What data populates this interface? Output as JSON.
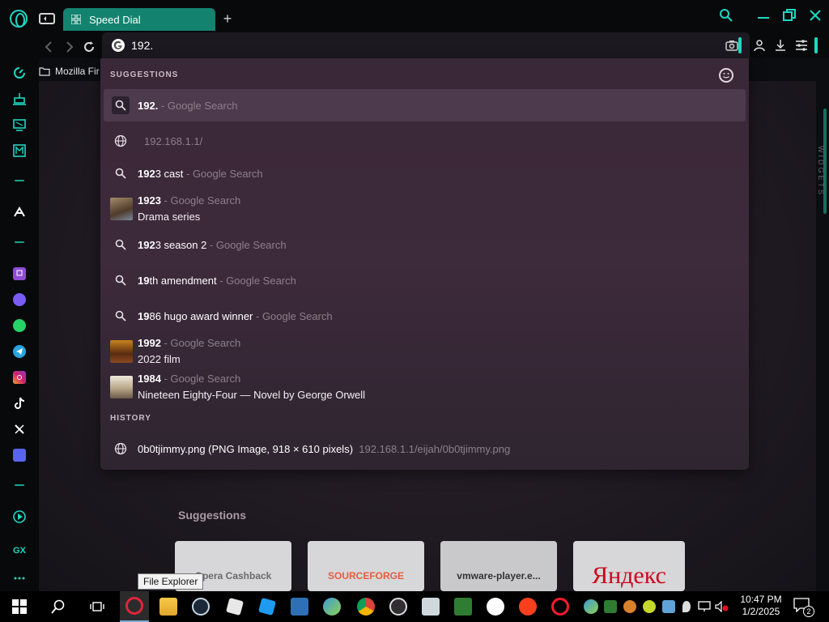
{
  "tab": {
    "title": "Speed Dial"
  },
  "address": {
    "value": "192."
  },
  "bookmarks": {
    "item": "Mozilla Fir"
  },
  "dropdown": {
    "heading": "SUGGESTIONS",
    "history_heading": "HISTORY",
    "rows": [
      {
        "bold": "192.",
        "rest": "",
        "suffix": " - Google Search",
        "sub": ""
      },
      {
        "bold": "",
        "rest": "",
        "suffix": "192.168.1.1/",
        "sub": ""
      },
      {
        "bold": "192",
        "rest": "3 cast",
        "suffix": " - Google Search",
        "sub": ""
      },
      {
        "bold": "1923",
        "rest": "",
        "suffix": " - Google Search",
        "sub": "Drama series"
      },
      {
        "bold": "192",
        "rest": "3 season 2",
        "suffix": " - Google Search",
        "sub": ""
      },
      {
        "bold": "19",
        "rest": "th amendment",
        "suffix": " - Google Search",
        "sub": ""
      },
      {
        "bold": "19",
        "rest": "86 hugo award winner",
        "suffix": " - Google Search",
        "sub": ""
      },
      {
        "bold": "1992",
        "rest": "",
        "suffix": " - Google Search",
        "sub": "2022 film"
      },
      {
        "bold": "1984",
        "rest": "",
        "suffix": " - Google Search",
        "sub": "Nineteen Eighty-Four — Novel by George Orwell"
      }
    ],
    "history": {
      "title": "0b0tjimmy.png (PNG Image, 918 × 610 pixels)",
      "url": "192.168.1.1/eijah/0b0tjimmy.png"
    }
  },
  "speed_dial": {
    "heading": "Suggestions",
    "tiles": [
      "Opera Cashback",
      "SOURCEFORGE",
      "vmware-player.e...",
      "Яндекс"
    ]
  },
  "sidebar": {
    "widgets_label": "WIDGETS",
    "gx_label": "GX"
  },
  "taskbar": {
    "tooltip": "File Explorer",
    "time": "10:47 PM",
    "date": "1/2/2025",
    "notifications": "2"
  },
  "colors": {
    "accent": "#1ed7c2",
    "tab": "#13836f",
    "dropdown": "#3a2737",
    "selected_row": "#4d3a4c"
  }
}
